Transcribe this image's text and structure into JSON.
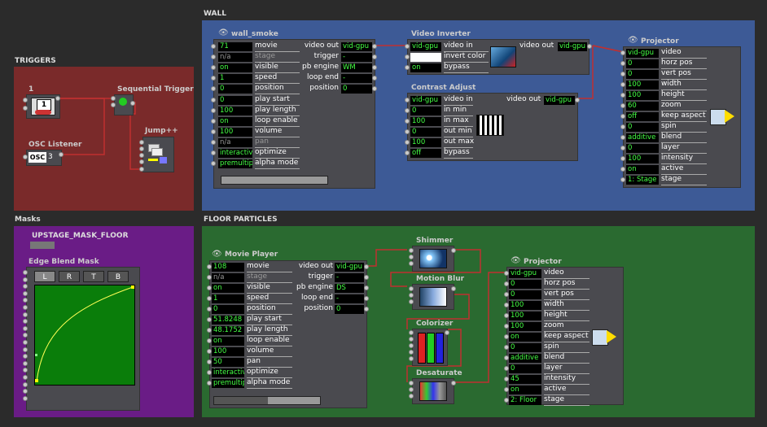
{
  "groups": {
    "triggers": "TRIGGERS",
    "wall": "WALL",
    "masks": "Masks",
    "floor": "FLOOR PARTICLES"
  },
  "colors": {
    "triggers_bg": "#7a2a2a",
    "wall_bg": "#3d5a96",
    "masks_bg": "#6a1c86",
    "floor_bg": "#2a6a30",
    "value_text": "#44ff44",
    "wire": "#b83030"
  },
  "triggers": {
    "keyboard": {
      "title": "1",
      "key": "1"
    },
    "osc": {
      "title": "OSC Listener",
      "value": "3",
      "icon_label": "OSC"
    },
    "seq": {
      "title": "Sequential Trigger"
    },
    "jump": {
      "title": "Jump++"
    }
  },
  "wall_smoke": {
    "title": "wall_smoke",
    "inputs": [
      {
        "value": "71",
        "label": "movie"
      },
      {
        "value": "n/a",
        "label": "stage",
        "dim": true
      },
      {
        "value": "on",
        "label": "visible"
      },
      {
        "value": "1",
        "label": "speed"
      },
      {
        "value": "0",
        "label": "position"
      },
      {
        "value": "0",
        "label": "play start"
      },
      {
        "value": "100",
        "label": "play length"
      },
      {
        "value": "on",
        "label": "loop enable"
      },
      {
        "value": "100",
        "label": "volume"
      },
      {
        "value": "n/a",
        "label": "pan",
        "dim": true
      },
      {
        "value": "interactive",
        "label": "optimize"
      },
      {
        "value": "premultiplied",
        "label": "alpha mode"
      }
    ],
    "outputs": [
      {
        "label": "video out",
        "value": "vid-gpu"
      },
      {
        "label": "trigger",
        "value": "-"
      },
      {
        "label": "pb engine",
        "value": "WM"
      },
      {
        "label": "loop end",
        "value": "-"
      },
      {
        "label": "position",
        "value": "0"
      }
    ]
  },
  "video_inverter": {
    "title": "Video Inverter",
    "inputs": [
      {
        "value": "vid-gpu",
        "label": "video in"
      },
      {
        "value": "",
        "label": "invert color"
      },
      {
        "value": "on",
        "label": "bypass"
      }
    ],
    "output": {
      "label": "video out",
      "value": "vid-gpu"
    }
  },
  "contrast_adjust": {
    "title": "Contrast Adjust",
    "inputs": [
      {
        "value": "vid-gpu",
        "label": "video in"
      },
      {
        "value": "0",
        "label": "in min"
      },
      {
        "value": "100",
        "label": "in max"
      },
      {
        "value": "0",
        "label": "out min"
      },
      {
        "value": "100",
        "label": "out max"
      },
      {
        "value": "off",
        "label": "bypass"
      }
    ],
    "output": {
      "label": "video out",
      "value": "vid-gpu"
    }
  },
  "wall_projector": {
    "title": "Projector",
    "inputs": [
      {
        "value": "vid-gpu",
        "label": "video"
      },
      {
        "value": "0",
        "label": "horz pos"
      },
      {
        "value": "0",
        "label": "vert pos"
      },
      {
        "value": "100",
        "label": "width"
      },
      {
        "value": "100",
        "label": "height"
      },
      {
        "value": "60",
        "label": "zoom"
      },
      {
        "value": "off",
        "label": "keep aspect"
      },
      {
        "value": "0",
        "label": "spin"
      },
      {
        "value": "additive",
        "label": "blend"
      },
      {
        "value": "0",
        "label": "layer"
      },
      {
        "value": "100",
        "label": "intensity"
      },
      {
        "value": "on",
        "label": "active"
      },
      {
        "value": "1: Stage",
        "label": "stage"
      }
    ]
  },
  "masks": {
    "mask_name": "UPSTAGE_MASK_FLOOR",
    "edge_blend": {
      "title": "Edge Blend Mask",
      "buttons": [
        "L",
        "R",
        "T",
        "B"
      ],
      "selected": "L"
    }
  },
  "movie_player": {
    "title": "Movie Player",
    "inputs": [
      {
        "value": "108",
        "label": "movie"
      },
      {
        "value": "n/a",
        "label": "stage",
        "dim": true
      },
      {
        "value": "on",
        "label": "visible"
      },
      {
        "value": "1",
        "label": "speed"
      },
      {
        "value": "0",
        "label": "position"
      },
      {
        "value": "51.8248",
        "label": "play start"
      },
      {
        "value": "48.1752",
        "label": "play length"
      },
      {
        "value": "on",
        "label": "loop enable"
      },
      {
        "value": "100",
        "label": "volume"
      },
      {
        "value": "50",
        "label": "pan"
      },
      {
        "value": "interactive",
        "label": "optimize"
      },
      {
        "value": "premultiplied",
        "label": "alpha mode"
      }
    ],
    "outputs": [
      {
        "label": "video out",
        "value": "vid-gpu"
      },
      {
        "label": "trigger",
        "value": "-"
      },
      {
        "label": "pb engine",
        "value": "DS"
      },
      {
        "label": "loop end",
        "value": "-"
      },
      {
        "label": "position",
        "value": "0"
      }
    ]
  },
  "floor_fx": {
    "shimmer": "Shimmer",
    "motion_blur": "Motion Blur",
    "colorizer": "Colorizer",
    "desaturate": "Desaturate"
  },
  "floor_projector": {
    "title": "Projector",
    "inputs": [
      {
        "value": "vid-gpu",
        "label": "video"
      },
      {
        "value": "0",
        "label": "horz pos"
      },
      {
        "value": "0",
        "label": "vert pos"
      },
      {
        "value": "100",
        "label": "width"
      },
      {
        "value": "100",
        "label": "height"
      },
      {
        "value": "100",
        "label": "zoom"
      },
      {
        "value": "on",
        "label": "keep aspect"
      },
      {
        "value": "0",
        "label": "spin"
      },
      {
        "value": "additive",
        "label": "blend"
      },
      {
        "value": "0",
        "label": "layer"
      },
      {
        "value": "45",
        "label": "intensity"
      },
      {
        "value": "on",
        "label": "active"
      },
      {
        "value": "2: Floor",
        "label": "stage"
      }
    ]
  }
}
